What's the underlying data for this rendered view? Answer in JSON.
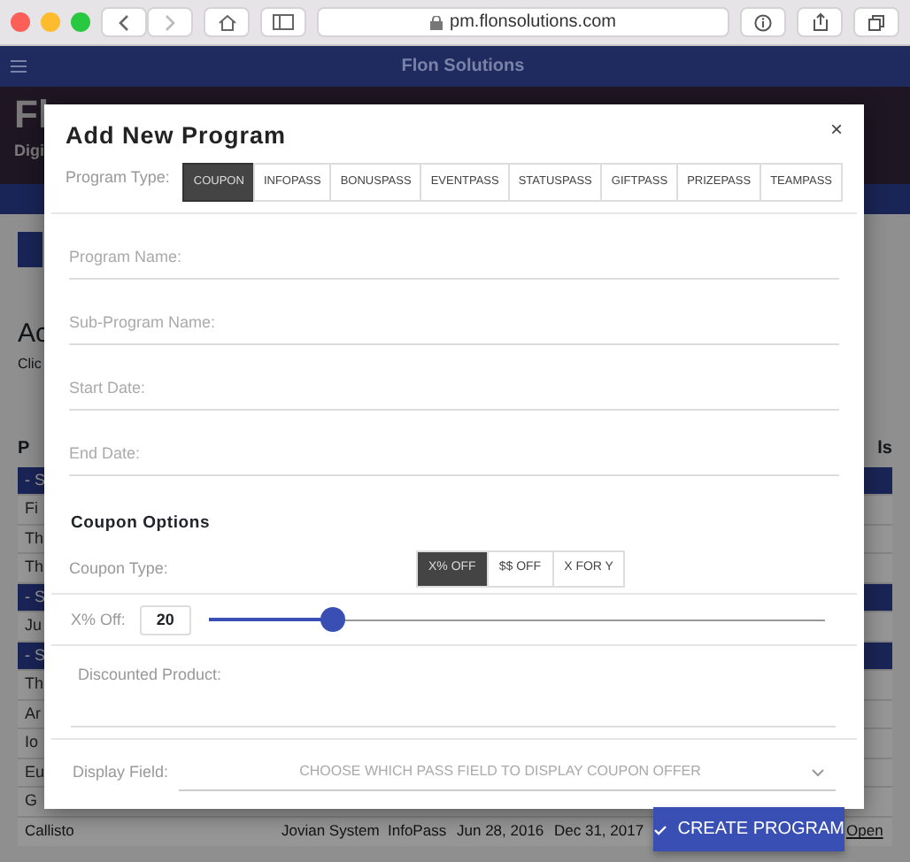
{
  "browser": {
    "url": "pm.flonsolutions.com"
  },
  "app": {
    "title": "Flon Solutions"
  },
  "background": {
    "hero_title": "Fl",
    "hero_subtitle": "Digi",
    "heading": "Ac",
    "subheading": "Clic",
    "column_1_header": "P",
    "last_column_header": "ls",
    "rows": [
      {
        "kind": "group",
        "text": "- S"
      },
      {
        "kind": "item",
        "text": "Fi"
      },
      {
        "kind": "item",
        "text": "Th"
      },
      {
        "kind": "item",
        "text": "Th"
      },
      {
        "kind": "group",
        "text": "- S"
      },
      {
        "kind": "item",
        "text": "Ju"
      },
      {
        "kind": "group",
        "text": "- S"
      },
      {
        "kind": "item",
        "text": "Th"
      },
      {
        "kind": "item",
        "text": "Ar"
      },
      {
        "kind": "item",
        "text": "Io"
      },
      {
        "kind": "item",
        "text": "Eu"
      },
      {
        "kind": "item",
        "text": "G"
      }
    ],
    "full_rows": [
      {
        "cells": [
          "Callisto",
          "Jovian System",
          "InfoPass",
          "Jun 28, 2016",
          "Dec 31, 2017",
          "Open"
        ]
      }
    ]
  },
  "modal": {
    "title": "Add New Program",
    "close": "×",
    "program_type_label": "Program Type:",
    "program_types": [
      {
        "label": "COUPON",
        "selected": true
      },
      {
        "label": "INFOPASS",
        "selected": false
      },
      {
        "label": "BONUSPASS",
        "selected": false
      },
      {
        "label": "EVENTPASS",
        "selected": false
      },
      {
        "label": "STATUSPASS",
        "selected": false
      },
      {
        "label": "GIFTPASS",
        "selected": false
      },
      {
        "label": "PRIZEPASS",
        "selected": false
      },
      {
        "label": "TEAMPASS",
        "selected": false
      }
    ],
    "fields": [
      {
        "placeholder": "Program Name:"
      },
      {
        "placeholder": "Sub-Program Name:"
      },
      {
        "placeholder": "Start Date:"
      },
      {
        "placeholder": "End Date:"
      }
    ],
    "coupon_options_title": "Coupon Options",
    "coupon_type_label": "Coupon Type:",
    "coupon_types": [
      {
        "label": "X% OFF",
        "selected": true
      },
      {
        "label": "$$ OFF",
        "selected": false
      },
      {
        "label": "X FOR Y",
        "selected": false
      }
    ],
    "discount_label": "X% Off:",
    "discount_value": "20",
    "discount_slider": {
      "level": 0.2
    },
    "discounted_product_label": "Discounted Product:",
    "display_field_label": "Display Field:",
    "display_field_placeholder": "CHOOSE WHICH PASS FIELD TO DISPLAY COUPON OFFER",
    "submit": "CREATE PROGRAM"
  }
}
